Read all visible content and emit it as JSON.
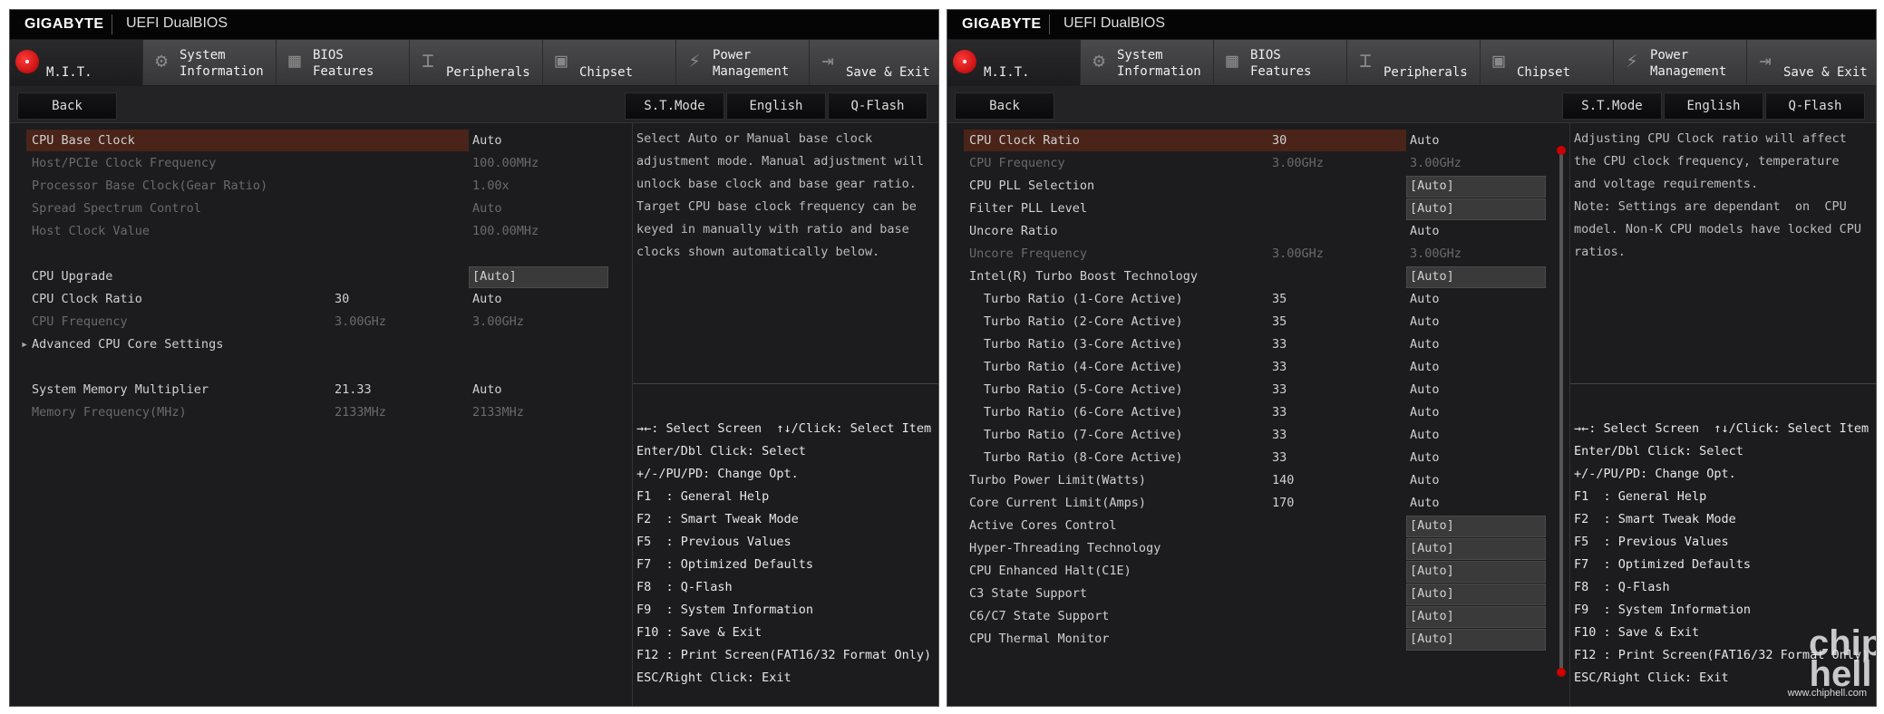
{
  "header": {
    "logo": "GIGABYTE",
    "product": "UEFI DualBIOS"
  },
  "tabs": [
    {
      "label": "M.I.T.",
      "icon": "mit-icon"
    },
    {
      "label": "System\nInformation",
      "icon": "gear-icon"
    },
    {
      "label": "BIOS\nFeatures",
      "icon": "bios-icon"
    },
    {
      "label": "Peripherals",
      "icon": "peripherals-icon"
    },
    {
      "label": "Chipset",
      "icon": "chipset-icon"
    },
    {
      "label": "Power\nManagement",
      "icon": "power-icon"
    },
    {
      "label": "Save & Exit",
      "icon": "exit-icon"
    }
  ],
  "toolbar": {
    "back": "Back",
    "stmode": "S.T.Mode",
    "language": "English",
    "qflash": "Q-Flash"
  },
  "left": {
    "rows": [
      {
        "name": "CPU Base Clock",
        "v1": "",
        "v2": "Auto",
        "state": "selected"
      },
      {
        "name": "Host/PCIe Clock Frequency",
        "v1": "",
        "v2": "100.00MHz",
        "state": "dim"
      },
      {
        "name": "Processor Base Clock(Gear Ratio)",
        "v1": "",
        "v2": "1.00x",
        "state": "dim"
      },
      {
        "name": "Spread Spectrum Control",
        "v1": "",
        "v2": "Auto",
        "state": "dim"
      },
      {
        "name": "Host Clock Value",
        "v1": "",
        "v2": "100.00MHz",
        "state": "dim"
      },
      {
        "name": "",
        "v1": "",
        "v2": "",
        "state": "blank"
      },
      {
        "name": "CPU Upgrade",
        "v1": "",
        "v2": "[Auto]",
        "state": "box"
      },
      {
        "name": "CPU Clock Ratio",
        "v1": "30",
        "v2": "Auto",
        "state": "normal"
      },
      {
        "name": "CPU Frequency",
        "v1": "3.00GHz",
        "v2": "3.00GHz",
        "state": "dim"
      },
      {
        "name": "Advanced CPU Core Settings",
        "v1": "",
        "v2": "",
        "state": "submenu"
      },
      {
        "name": "",
        "v1": "",
        "v2": "",
        "state": "blank"
      },
      {
        "name": "System Memory Multiplier",
        "v1": "21.33",
        "v2": "Auto",
        "state": "normal"
      },
      {
        "name": "Memory Frequency(MHz)",
        "v1": "2133MHz",
        "v2": "2133MHz",
        "state": "dim"
      }
    ],
    "help": "Select Auto or Manual base clock\nadjustment mode. Manual adjustment will\nunlock base clock and base gear ratio.\nTarget CPU base clock frequency can be\nkeyed in manually with ratio and base\nclocks shown automatically below."
  },
  "right": {
    "rows": [
      {
        "name": "CPU Clock Ratio",
        "v1": "30",
        "v2": "Auto",
        "state": "selected"
      },
      {
        "name": "CPU Frequency",
        "v1": "3.00GHz",
        "v2": "3.00GHz",
        "state": "dim"
      },
      {
        "name": "CPU PLL Selection",
        "v1": "",
        "v2": "[Auto]",
        "state": "box"
      },
      {
        "name": "Filter PLL Level",
        "v1": "",
        "v2": "[Auto]",
        "state": "box"
      },
      {
        "name": "Uncore Ratio",
        "v1": "",
        "v2": "Auto",
        "state": "normal"
      },
      {
        "name": "Uncore Frequency",
        "v1": "3.00GHz",
        "v2": "3.00GHz",
        "state": "dim"
      },
      {
        "name": "Intel(R) Turbo Boost Technology",
        "v1": "",
        "v2": "[Auto]",
        "state": "box"
      },
      {
        "name": "Turbo Ratio (1-Core Active)",
        "v1": "35",
        "v2": "Auto",
        "state": "sub"
      },
      {
        "name": "Turbo Ratio (2-Core Active)",
        "v1": "35",
        "v2": "Auto",
        "state": "sub"
      },
      {
        "name": "Turbo Ratio (3-Core Active)",
        "v1": "33",
        "v2": "Auto",
        "state": "sub"
      },
      {
        "name": "Turbo Ratio (4-Core Active)",
        "v1": "33",
        "v2": "Auto",
        "state": "sub"
      },
      {
        "name": "Turbo Ratio (5-Core Active)",
        "v1": "33",
        "v2": "Auto",
        "state": "sub"
      },
      {
        "name": "Turbo Ratio (6-Core Active)",
        "v1": "33",
        "v2": "Auto",
        "state": "sub"
      },
      {
        "name": "Turbo Ratio (7-Core Active)",
        "v1": "33",
        "v2": "Auto",
        "state": "sub"
      },
      {
        "name": "Turbo Ratio (8-Core Active)",
        "v1": "33",
        "v2": "Auto",
        "state": "sub"
      },
      {
        "name": "Turbo Power Limit(Watts)",
        "v1": "140",
        "v2": "Auto",
        "state": "normal"
      },
      {
        "name": "Core Current Limit(Amps)",
        "v1": "170",
        "v2": "Auto",
        "state": "normal"
      },
      {
        "name": "Active Cores Control",
        "v1": "",
        "v2": "[Auto]",
        "state": "box"
      },
      {
        "name": "Hyper-Threading Technology",
        "v1": "",
        "v2": "[Auto]",
        "state": "box"
      },
      {
        "name": "CPU Enhanced Halt(C1E)",
        "v1": "",
        "v2": "[Auto]",
        "state": "box"
      },
      {
        "name": "C3 State Support",
        "v1": "",
        "v2": "[Auto]",
        "state": "box"
      },
      {
        "name": "C6/C7 State Support",
        "v1": "",
        "v2": "[Auto]",
        "state": "box"
      },
      {
        "name": "CPU Thermal Monitor",
        "v1": "",
        "v2": "[Auto]",
        "state": "box"
      }
    ],
    "help": "Adjusting CPU Clock ratio will affect\nthe CPU clock frequency, temperature\nand voltage requirements.\nNote: Settings are dependant  on  CPU\nmodel. Non-K CPU models have locked CPU\nratios."
  },
  "keys": "→←: Select Screen  ↑↓/Click: Select Item\nEnter/Dbl Click: Select\n+/-/PU/PD: Change Opt.\nF1  : General Help\nF2  : Smart Tweak Mode\nF5  : Previous Values\nF7  : Optimized Defaults\nF8  : Q-Flash\nF9  : System Information\nF10 : Save & Exit\nF12 : Print Screen(FAT16/32 Format Only)\nESC/Right Click: Exit",
  "watermark": {
    "text": "www.chiphell.com",
    "logo": "chip\nhell"
  },
  "colors": {
    "selected_bg": "#4a2418",
    "scroll_dot": "#cc0000",
    "mit_red": "#e00000"
  }
}
